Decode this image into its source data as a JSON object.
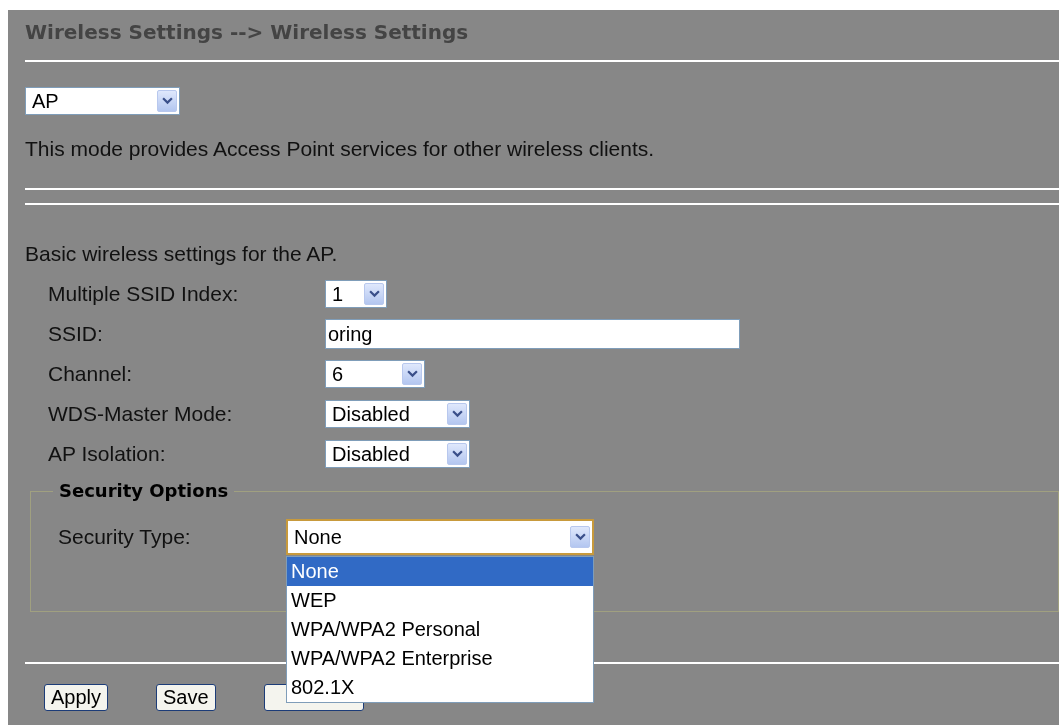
{
  "header": {
    "title": "Wireless Settings --> Wireless Settings"
  },
  "mode": {
    "value": "AP",
    "description": "This mode provides Access Point services for other wireless clients."
  },
  "basic": {
    "heading": "Basic wireless settings for the AP.",
    "fields": [
      {
        "label": "Multiple SSID Index:",
        "kind": "select",
        "value": "1"
      },
      {
        "label": "SSID:",
        "kind": "text",
        "value": "oring"
      },
      {
        "label": "Channel:",
        "kind": "select",
        "value": "6"
      },
      {
        "label": "WDS-Master Mode:",
        "kind": "select",
        "value": "Disabled"
      },
      {
        "label": "AP Isolation:",
        "kind": "select",
        "value": "Disabled"
      }
    ]
  },
  "security": {
    "legend": "Security Options",
    "label": "Security Type:",
    "value": "None",
    "expanded": true,
    "options": [
      {
        "label": "None",
        "selected": true
      },
      {
        "label": "WEP",
        "selected": false
      },
      {
        "label": "WPA/WPA2 Personal",
        "selected": false
      },
      {
        "label": "WPA/WPA2 Enterprise",
        "selected": false
      },
      {
        "label": "802.1X",
        "selected": false
      }
    ]
  },
  "buttons": [
    {
      "kind": "labeled",
      "label": "Apply"
    },
    {
      "kind": "labeled",
      "label": "Save"
    },
    {
      "kind": "covered"
    }
  ]
}
